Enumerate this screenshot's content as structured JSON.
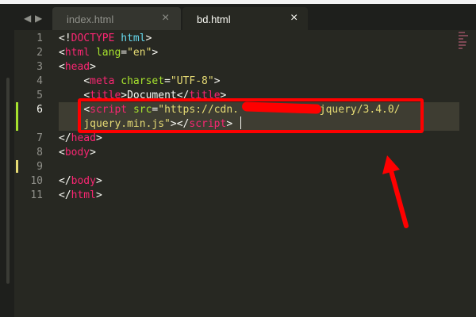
{
  "tabs": [
    {
      "label": "index.html",
      "close": "×",
      "active": false
    },
    {
      "label": "bd.html",
      "close": "×",
      "active": true
    }
  ],
  "nav": {
    "back": "◀",
    "forward": "▶"
  },
  "line_numbers": [
    "1",
    "2",
    "3",
    "4",
    "5",
    "6",
    "",
    "7",
    "8",
    "9",
    "10",
    "11"
  ],
  "code": {
    "l1_lt": "<!",
    "l1_kw": "DOCTYPE",
    "l1_dt": "html",
    "l1_gt": ">",
    "l2_lt": "<",
    "l2_tag": "html",
    "l2_attr": "lang",
    "l2_eq": "=",
    "l2_val": "\"en\"",
    "l2_gt": ">",
    "l3_lt": "<",
    "l3_tag": "head",
    "l3_gt": ">",
    "l4_lt": "<",
    "l4_tag": "meta",
    "l4_attr": "charset",
    "l4_eq": "=",
    "l4_val": "\"UTF-8\"",
    "l4_gt": ">",
    "l5_lt": "<",
    "l5_tag": "title",
    "l5_gt": ">",
    "l5_text": "Document",
    "l5_close_lt": "</",
    "l5_close_tag": "title",
    "l5_close_gt": ">",
    "l6_lt": "<",
    "l6_tag": "script",
    "l6_attr": "src",
    "l6_eq": "=",
    "l6_val_a": "\"https://cdn.",
    "l6_val_b": "com/jquery/3.4.0/",
    "l6b_val": "jquery.min.js\"",
    "l6b_gt": ">",
    "l6b_close_lt": "</",
    "l6b_close_tag": "script",
    "l6b_close_gt": ">",
    "l7_lt": "</",
    "l7_tag": "head",
    "l7_gt": ">",
    "l8_lt": "<",
    "l8_tag": "body",
    "l8_gt": ">",
    "l10_lt": "</",
    "l10_tag": "body",
    "l10_gt": ">",
    "l11_lt": "</",
    "l11_tag": "html",
    "l11_gt": ">"
  },
  "colors": {
    "highlight": "#ff0000",
    "editor_bg": "#272822",
    "tag": "#f92672",
    "attr": "#a6e22e",
    "string": "#e6db74"
  }
}
